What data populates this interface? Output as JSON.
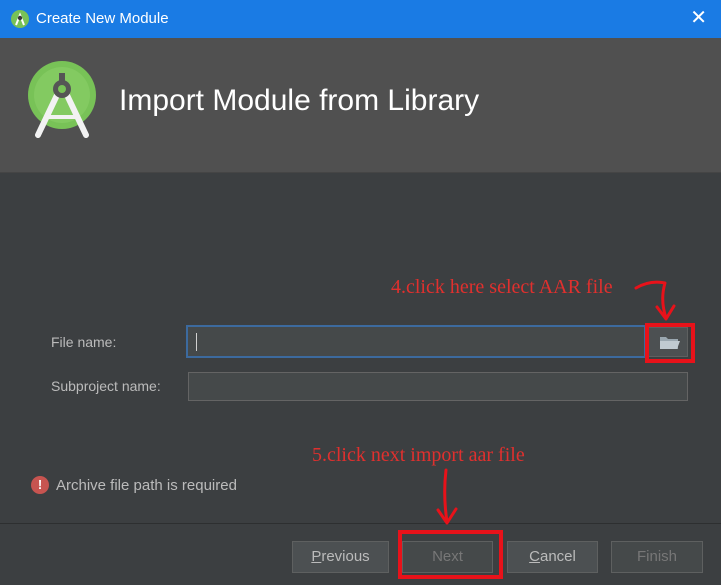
{
  "window": {
    "title": "Create New Module",
    "close_glyph": "✕",
    "app_icon": "android-studio-icon",
    "title_bar_color": "#1a7be4"
  },
  "header": {
    "heading": "Import Module from Library",
    "logo_icon": "android-studio-logo"
  },
  "form": {
    "file_name_label": "File name:",
    "file_name_value": "",
    "browse_icon": "folder-icon",
    "subproject_label": "Subproject name:",
    "subproject_value": ""
  },
  "validation": {
    "icon_glyph": "!",
    "message": "Archive file path is required"
  },
  "buttons": {
    "previous_label": "revious",
    "previous_mnemonic": "P",
    "next_label": "Next",
    "cancel_label": "ancel",
    "cancel_mnemonic": "C",
    "finish_label": "Finish"
  },
  "annotations": {
    "step4": "4.click here select AAR file",
    "step5": "5.click next import aar file",
    "color": "#e8121a"
  }
}
